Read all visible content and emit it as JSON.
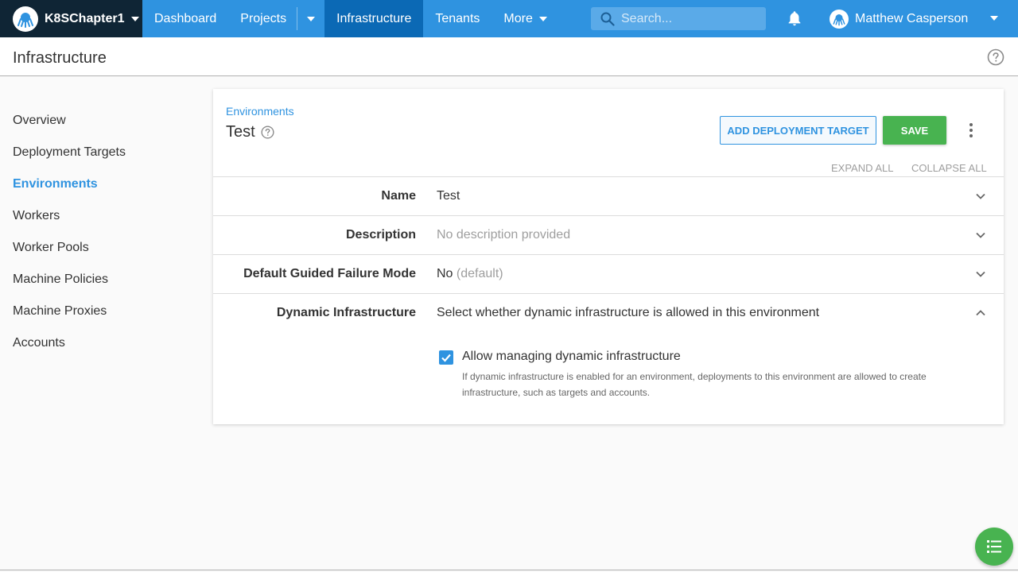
{
  "colors": {
    "nav_blue": "#2f93e0",
    "nav_active": "#0b69b5",
    "space_bg": "#0f2535",
    "save_green": "#48b350"
  },
  "topnav": {
    "space_name": "K8SChapter1",
    "items": [
      {
        "label": "Dashboard"
      },
      {
        "label": "Projects"
      },
      {
        "label": "Infrastructure",
        "active": true
      },
      {
        "label": "Tenants"
      },
      {
        "label": "More"
      }
    ],
    "search_placeholder": "Search...",
    "user_name": "Matthew Casperson",
    "icons": [
      "octopus-logo-icon",
      "search-icon",
      "bell-icon",
      "user-avatar-icon"
    ]
  },
  "header": {
    "title": "Infrastructure"
  },
  "sidebar": {
    "items": [
      {
        "label": "Overview"
      },
      {
        "label": "Deployment Targets"
      },
      {
        "label": "Environments",
        "active": true
      },
      {
        "label": "Workers"
      },
      {
        "label": "Worker Pools"
      },
      {
        "label": "Machine Policies"
      },
      {
        "label": "Machine Proxies"
      },
      {
        "label": "Accounts"
      }
    ]
  },
  "card": {
    "breadcrumb": "Environments",
    "env_name": "Test",
    "add_target_label": "ADD DEPLOYMENT TARGET",
    "save_label": "SAVE",
    "expand_all": "EXPAND ALL",
    "collapse_all": "COLLAPSE ALL",
    "rows": [
      {
        "label": "Name",
        "value": "Test"
      },
      {
        "label": "Description",
        "value": "No description provided"
      },
      {
        "label": "Default Guided Failure Mode",
        "value": "No",
        "value_suffix": "(default)"
      },
      {
        "label": "Dynamic Infrastructure",
        "value": "Select whether dynamic infrastructure is allowed in this environment"
      }
    ],
    "dynamic": {
      "checkbox_label": "Allow managing dynamic infrastructure",
      "checked": true,
      "help_text": "If dynamic infrastructure is enabled for an environment, deployments to this environment are allowed to create infrastructure, such as targets and accounts."
    }
  }
}
